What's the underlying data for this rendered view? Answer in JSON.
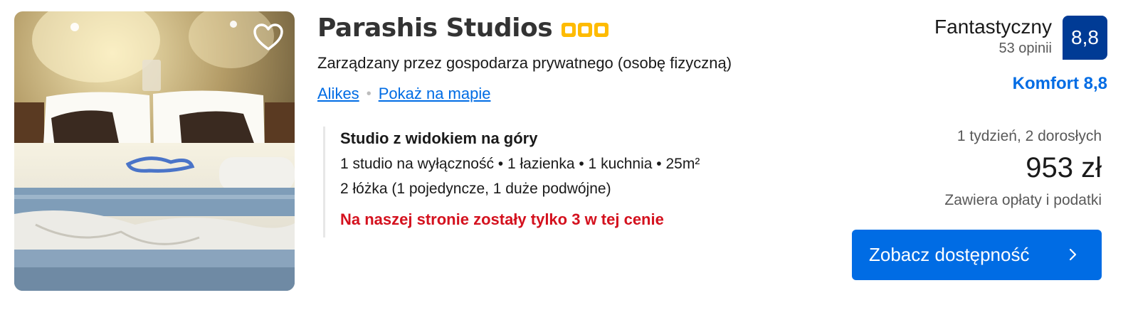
{
  "property": {
    "name": "Parashis Studios",
    "stars": 3,
    "managed_by": "Zarządzany przez gospodarza prywatnego (osobę fizyczną)",
    "location_link": "Alikes",
    "map_link": "Pokaż na mapie"
  },
  "room": {
    "name": "Studio z widokiem na góry",
    "details": "1 studio na wyłączność • 1 łazienka • 1 kuchnia • 25m²",
    "beds": "2 łóżka (1 pojedyncze, 1 duże podwójne)",
    "scarcity": "Na naszej stronie zostały tylko 3 w tej cenie"
  },
  "review": {
    "label": "Fantastyczny",
    "count": "53 opinii",
    "score": "8,8",
    "comfort": "Komfort 8,8"
  },
  "pricing": {
    "stay": "1 tydzień, 2 dorosłych",
    "price": "953 zł",
    "taxes": "Zawiera opłaty i podatki"
  },
  "cta": {
    "label": "Zobacz dostępność"
  },
  "icons": {
    "favorite": "heart-icon",
    "cta_arrow": "chevron-right-icon",
    "rating": "star-square-icon"
  },
  "colors": {
    "link": "#006ce4",
    "score_bg": "#003b95",
    "scarcity": "#d4111e",
    "star": "#febb02"
  }
}
